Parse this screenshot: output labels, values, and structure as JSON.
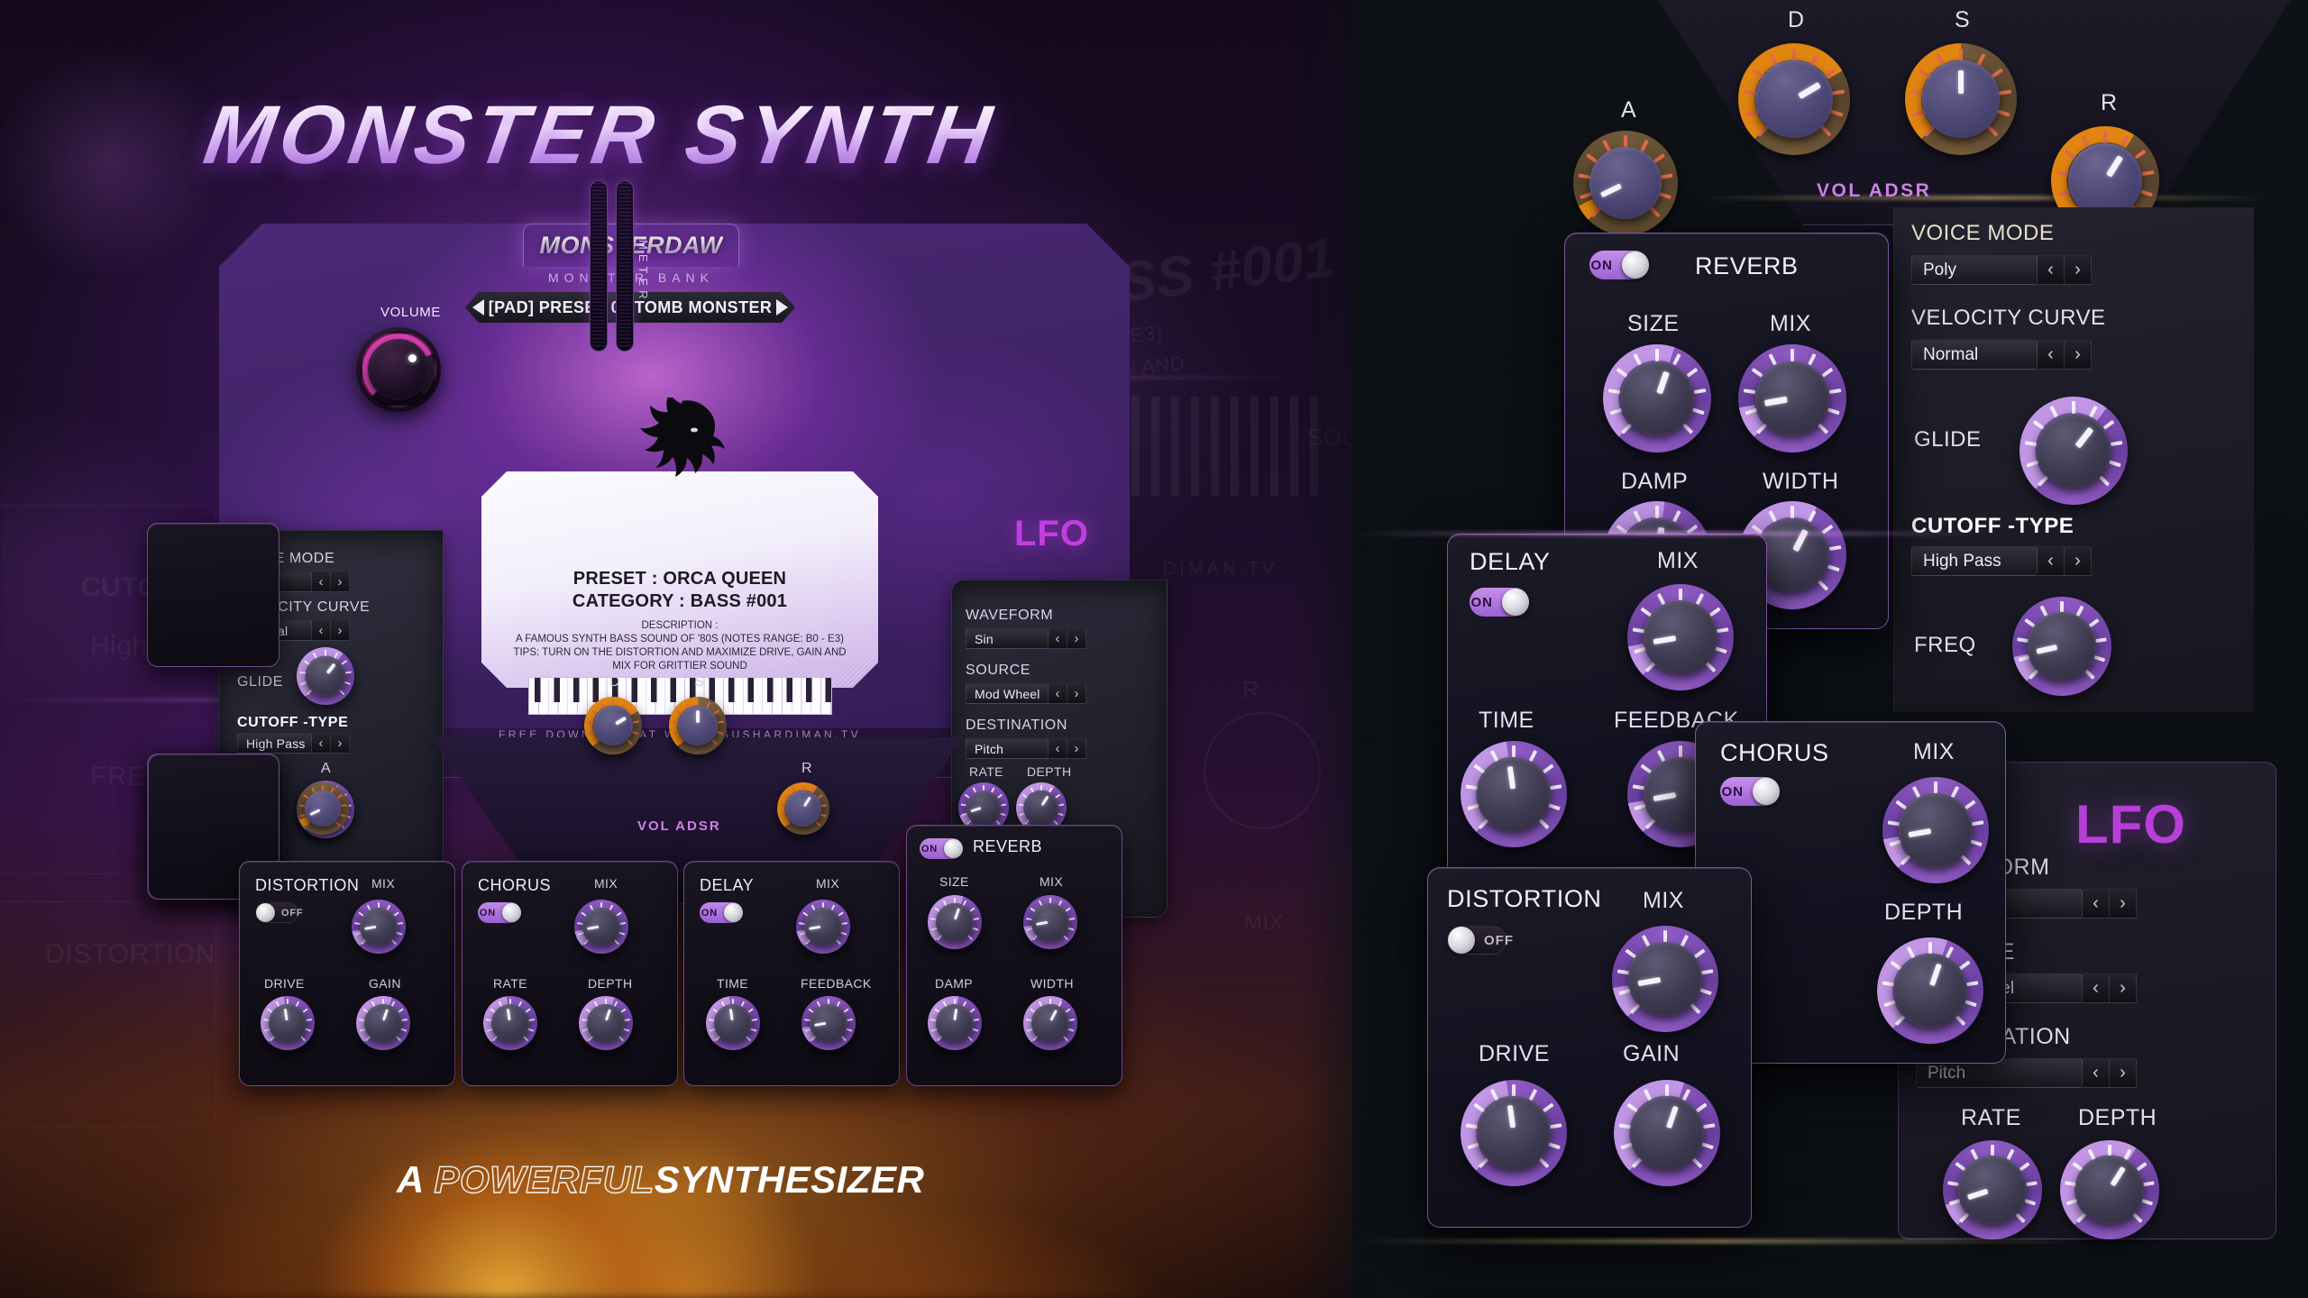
{
  "brand": {
    "title": "MONSTER SYNTH",
    "tagline_prefix": "A ",
    "tagline_outline": "POWERFUL",
    "tagline_solid": "SYNTHESIZER"
  },
  "header": {
    "daw_name": "MONSTERDAW",
    "bank_name": "MONSTER BANK",
    "preset_display": "[PAD]  PRESET 03  TOMB MONSTER",
    "prev_icon": "triangle-left-icon",
    "next_icon": "triangle-right-icon"
  },
  "card": {
    "preset_line": "PRESET : ORCA QUEEN",
    "category_line": "CATEGORY : BASS #001",
    "description_label": "DESCRIPTION :",
    "description_line_1": "A FAMOUS SYNTH BASS SOUND OF '80S (NOTES RANGE: B0 - E3)",
    "description_line_2": "TIPS: TURN ON THE DISTORTION AND MAXIMIZE DRIVE, GAIN AND",
    "description_line_3": "MIX FOR GRITTIER SOUND",
    "footer": "FREE DOWNLOAD AT WWW.AGUSHARDIMAN.TV"
  },
  "master": {
    "volume_label": "VOLUME",
    "meter_label": "METER"
  },
  "voice": {
    "voice_mode_label": "VOICE MODE",
    "voice_mode_value": "Poly",
    "velocity_curve_label": "VELOCITY CURVE",
    "velocity_curve_value": "Normal",
    "glide_label": "GLIDE",
    "cutoff_type_label": "CUTOFF -TYPE",
    "cutoff_type_value": "High Pass",
    "freq_label": "FREQ"
  },
  "lfo": {
    "title": "LFO",
    "waveform_label": "WAVEFORM",
    "waveform_value": "Sin",
    "source_label": "SOURCE",
    "source_value": "Mod Wheel",
    "destination_label": "DESTINATION",
    "destination_value": "Pitch",
    "rate_label": "RATE",
    "depth_label": "DEPTH"
  },
  "adsr": {
    "section_label": "VOL ADSR",
    "a_label": "A",
    "d_label": "D",
    "s_label": "S",
    "r_label": "R"
  },
  "effects": {
    "distortion": {
      "title": "DISTORTION",
      "state": "OFF",
      "mix_label": "MIX",
      "drive_label": "DRIVE",
      "gain_label": "GAIN"
    },
    "chorus": {
      "title": "CHORUS",
      "state": "ON",
      "mix_label": "MIX",
      "rate_label": "RATE",
      "depth_label": "DEPTH"
    },
    "delay": {
      "title": "DELAY",
      "state": "ON",
      "mix_label": "MIX",
      "time_label": "TIME",
      "feedback_label": "FEEDBACK"
    },
    "reverb": {
      "title": "REVERB",
      "state": "ON",
      "size_label": "SIZE",
      "mix_label": "MIX",
      "damp_label": "DAMP",
      "width_label": "WIDTH"
    }
  },
  "colors": {
    "accent_purple": "#b63fd6",
    "accent_violet": "#9a5fd0",
    "adsr_orange": "#e8880f",
    "volume_magenta": "#d43bb0",
    "panel_dark": "#0f0e19",
    "card_white": "#fbfbfe"
  }
}
